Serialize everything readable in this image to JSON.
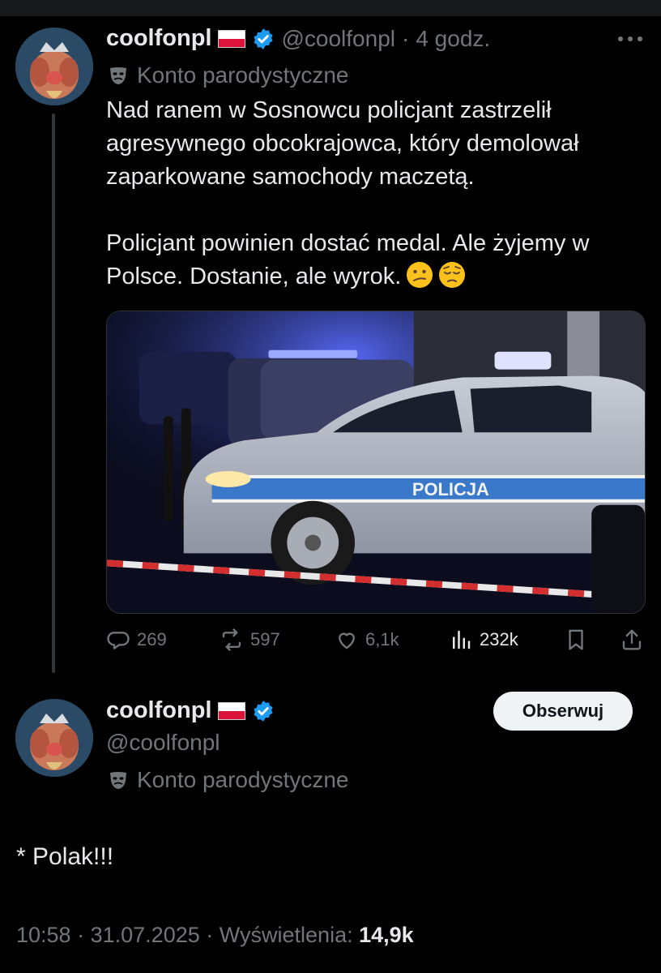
{
  "tweet": {
    "display_name": "coolfonpl",
    "handle": "@coolfonpl",
    "time_sep": "·",
    "relative_time": "4 godz.",
    "parody_label": "Konto parodystyczne",
    "text_p1": "Nad ranem w Sosnowcu policjant zastrzelił agresywnego obcokrajowca, który demolował zaparkowane samochody maczetą.",
    "text_p2": "Policjant powinien dostać medal. Ale żyjemy w Polsce. Dostanie, ale wyrok.",
    "image_sign_text": "POLICJA",
    "actions": {
      "replies": "269",
      "reposts": "597",
      "likes": "6,1k",
      "views": "232k"
    }
  },
  "reply": {
    "display_name": "coolfonpl",
    "handle": "@coolfonpl",
    "parody_label": "Konto parodystyczne",
    "follow_label": "Obserwuj",
    "text": "* Polak!!!",
    "time": "10:58",
    "sep": "·",
    "date": "31.07.2025",
    "views_label": "Wyświetlenia:",
    "views_count": "14,9k"
  },
  "colors": {
    "background": "#000000",
    "text": "#e7e9ea",
    "secondary": "#71767b",
    "verified": "#1d9bf0",
    "follow_bg": "#eff3f4"
  },
  "icons": [
    "reply-icon",
    "repost-icon",
    "like-icon",
    "views-icon",
    "bookmark-icon",
    "share-icon",
    "more-icon",
    "verified-badge-icon",
    "parody-mask-icon",
    "poland-flag-icon"
  ]
}
